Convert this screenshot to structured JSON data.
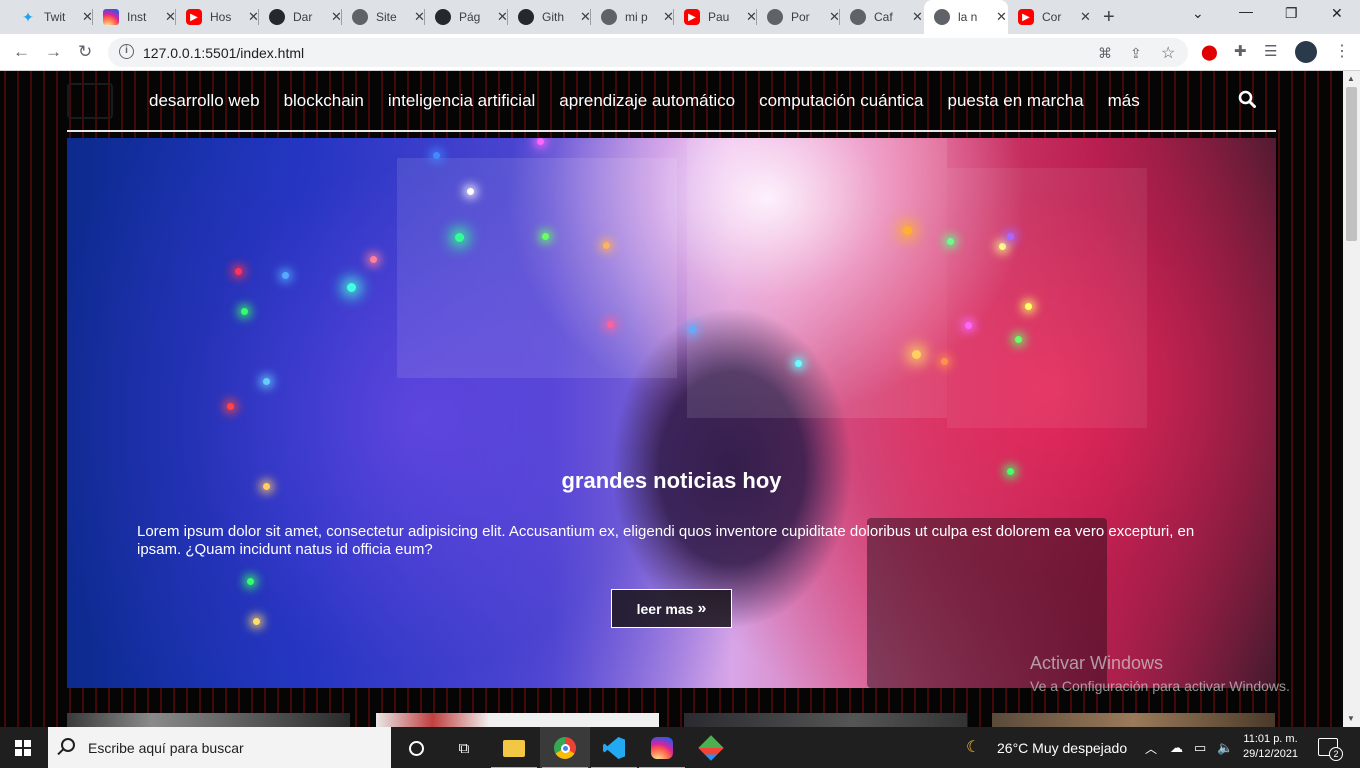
{
  "browser": {
    "tabs": [
      {
        "title": "Twit",
        "icon": "twitter-icon"
      },
      {
        "title": "Inst",
        "icon": "instagram-icon"
      },
      {
        "title": "Hos",
        "icon": "youtube-icon"
      },
      {
        "title": "Dar",
        "icon": "github-icon"
      },
      {
        "title": "Site",
        "icon": "globe-icon"
      },
      {
        "title": "Pág",
        "icon": "github-icon"
      },
      {
        "title": "Gith",
        "icon": "github-icon"
      },
      {
        "title": "mi p",
        "icon": "globe-icon"
      },
      {
        "title": "Pau",
        "icon": "youtube-icon"
      },
      {
        "title": "Por",
        "icon": "globe-icon"
      },
      {
        "title": "Caf",
        "icon": "globe-icon"
      },
      {
        "title": "la n",
        "icon": "globe-icon",
        "active": true
      },
      {
        "title": "Cor",
        "icon": "youtube-icon"
      }
    ],
    "url": "127.0.0.1:5501/index.html"
  },
  "site": {
    "nav": [
      "desarrollo web",
      "blockchain",
      "inteligencia artificial",
      "aprendizaje automático",
      "computación cuántica",
      "puesta en marcha",
      "más"
    ],
    "hero": {
      "title": "grandes noticias hoy",
      "text": "Lorem ipsum dolor sit amet, consectetur adipisicing elit. Accusantium ex, eligendi quos inventore cupiditate doloribus ut culpa est dolorem ea vero excepturi, en ipsam. ¿Quam incidunt natus id officia eum?",
      "button": "leer mas",
      "button_icon": "»"
    }
  },
  "os": {
    "activate_title": "Activar Windows",
    "activate_sub": "Ve a Configuración para activar Windows.",
    "search_placeholder": "Escribe aquí para buscar",
    "weather": "26°C  Muy despejado",
    "time": "11:01 p. m.",
    "date": "29/12/2021",
    "notifications": "2"
  }
}
